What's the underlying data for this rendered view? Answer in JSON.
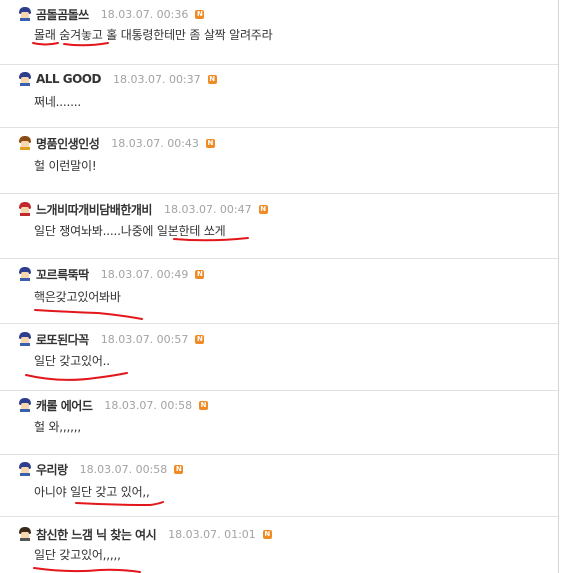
{
  "comments": [
    {
      "nick": "곰돌곰돌쓰",
      "date": "18.03.07.  00:36",
      "badge": "N",
      "text": "몰래 숨겨놓고 홀 대통령한테만 좀 살짝 알려주라"
    },
    {
      "nick": "ALL GOOD",
      "date": "18.03.07.  00:37",
      "badge": "N",
      "text": "쩌네......."
    },
    {
      "nick": "명품인생인성",
      "date": "18.03.07.  00:43",
      "badge": "N",
      "text": "헐 이런말이!"
    },
    {
      "nick": "느개비따개비담배한개비",
      "date": "18.03.07.  00:47",
      "badge": "N",
      "text": "일단 쟁여놔봐.....나중에 일본한테 쏘게"
    },
    {
      "nick": "꼬르륵뚝딱",
      "date": "18.03.07.  00:49",
      "badge": "N",
      "text": "핵은갖고있어봐바"
    },
    {
      "nick": "로또된다꼭",
      "date": "18.03.07.  00:57",
      "badge": "N",
      "text": "일단 갖고있어.."
    },
    {
      "nick": "캐롤 에어드",
      "date": "18.03.07.  00:58",
      "badge": "N",
      "text": "헐 와,,,,,,"
    },
    {
      "nick": "우리랑",
      "date": "18.03.07.  00:58",
      "badge": "N",
      "text": "아니야 일단 갖고 있어,,"
    },
    {
      "nick": "참신한 느갬 닉 찾는 여시",
      "date": "18.03.07.  01:01",
      "badge": "N",
      "text": "일단 갖고있어,,,,,"
    }
  ],
  "colors": {
    "underline": "#e3161b",
    "badge": "#f08a24",
    "nick": "#333333",
    "date": "#a3a3a3"
  }
}
